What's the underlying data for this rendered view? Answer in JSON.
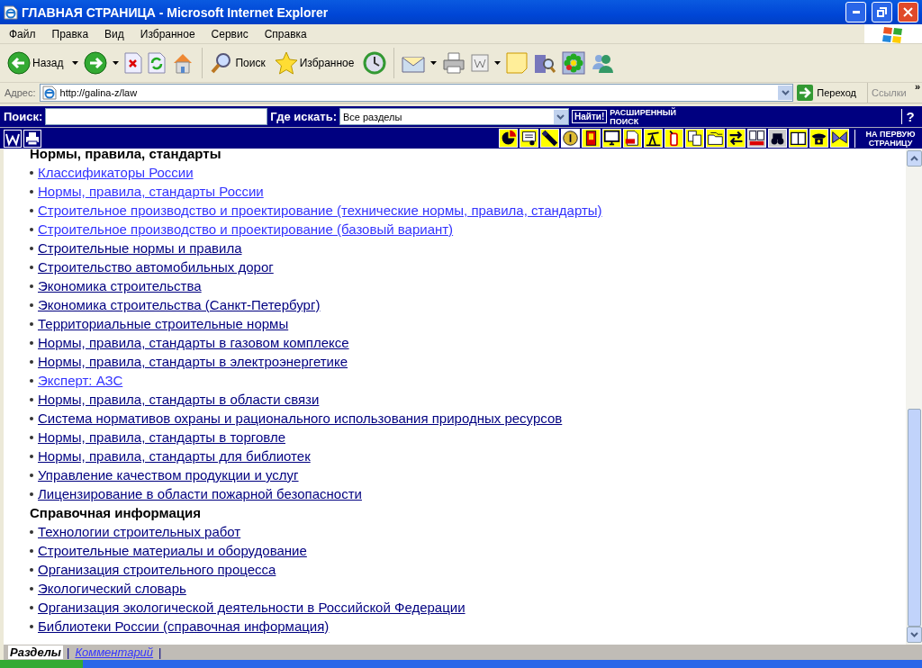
{
  "window": {
    "title": "ГЛАВНАЯ СТРАНИЦА - Microsoft Internet Explorer"
  },
  "menu": [
    "Файл",
    "Правка",
    "Вид",
    "Избранное",
    "Сервис",
    "Справка"
  ],
  "toolbar": {
    "back": "Назад",
    "search": "Поиск",
    "favorites": "Избранное"
  },
  "address_bar": {
    "label": "Адрес:",
    "url": "http://galina-z/law",
    "go": "Переход",
    "links": "Ссылки",
    "more": "»"
  },
  "site_search": {
    "label": "Поиск:",
    "where_label": "Где искать:",
    "where_value": "Все разделы",
    "find_button": "Найти!",
    "advanced": "РАСШИРЕННЫЙ ПОИСК",
    "help": "?",
    "home_link": "НА ПЕРВУЮ СТРАНИЦУ"
  },
  "sections": [
    {
      "title": "Нормы, правила, стандарты",
      "links": [
        {
          "text": "Классификаторы России",
          "visited": false
        },
        {
          "text": "Нормы, правила, стандарты России",
          "visited": false
        },
        {
          "text": "Строительное производство и проектирование (технические нормы, правила, стандарты)",
          "visited": false
        },
        {
          "text": "Строительное производство и проектирование (базовый вариант)",
          "visited": false
        },
        {
          "text": "Строительные нормы и правила",
          "visited": true
        },
        {
          "text": "Строительство автомобильных дорог",
          "visited": true
        },
        {
          "text": "Экономика строительства",
          "visited": true
        },
        {
          "text": "Экономика строительства (Санкт-Петербург)",
          "visited": true
        },
        {
          "text": "Территориальные строительные нормы",
          "visited": true
        },
        {
          "text": "Нормы, правила, стандарты в газовом комплексе",
          "visited": true
        },
        {
          "text": "Нормы, правила, стандарты в электроэнергетике",
          "visited": true
        },
        {
          "text": "Эксперт: АЗС",
          "visited": false
        },
        {
          "text": "Нормы, правила, стандарты в области связи",
          "visited": true
        },
        {
          "text": "Система нормативов охраны и рационального использования природных ресурсов",
          "visited": true
        },
        {
          "text": "Нормы, правила, стандарты в торговле",
          "visited": true
        },
        {
          "text": "Нормы, правила, стандарты для библиотек",
          "visited": true
        },
        {
          "text": "Управление качеством продукции и услуг",
          "visited": true
        },
        {
          "text": "Лицензирование в области пожарной безопасности",
          "visited": true
        }
      ]
    },
    {
      "title": "Справочная информация",
      "links": [
        {
          "text": "Технологии строительных работ",
          "visited": true
        },
        {
          "text": "Строительные материалы и оборудование",
          "visited": true
        },
        {
          "text": "Организация строительного процесса",
          "visited": true
        },
        {
          "text": "Экологический словарь",
          "visited": true
        },
        {
          "text": "Организация экологической деятельности в Российской Федерации",
          "visited": true
        },
        {
          "text": "Библиотеки России (справочная информация)",
          "visited": true
        }
      ]
    }
  ],
  "bottom_tabs": [
    {
      "label": "Разделы",
      "selected": true
    },
    {
      "label": "Комментарий",
      "selected": false
    }
  ],
  "bottom_tab_separators": [
    "|",
    "|"
  ]
}
